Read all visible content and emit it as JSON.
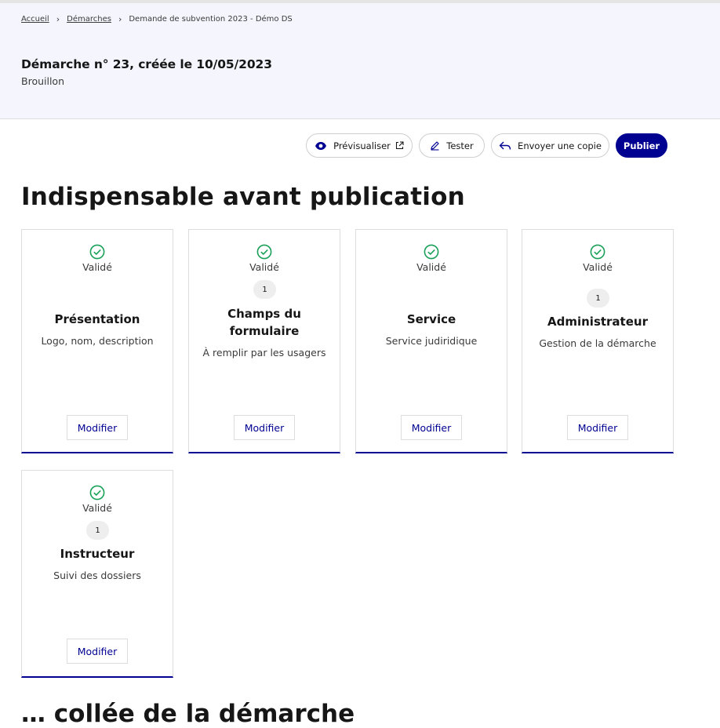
{
  "breadcrumb": {
    "home": "Accueil",
    "procedures": "Démarches",
    "current": "Demande de subvention 2023 - Démo DS"
  },
  "header": {
    "title": "Démarche n° 23, créée le 10/05/2023",
    "status": "Brouillon"
  },
  "actions": {
    "preview": "Prévisualiser",
    "test": "Tester",
    "send_copy": "Envoyer une copie",
    "publish": "Publier"
  },
  "section": {
    "title": "Indispensable avant publication",
    "next_title": "… collée de la démarche"
  },
  "cards": [
    {
      "status": "Validé",
      "badge": "",
      "title": "Présentation",
      "description": "Logo, nom, description",
      "button": "Modifier"
    },
    {
      "status": "Validé",
      "badge": "1",
      "title": "Champs du formulaire",
      "description": "À remplir par les usagers",
      "button": "Modifier"
    },
    {
      "status": "Validé",
      "badge": "",
      "title": "Service",
      "description": "Service judiridique",
      "button": "Modifier"
    },
    {
      "status": "Validé",
      "badge": "1",
      "title": "Administrateur",
      "description": "Gestion de la démarche",
      "button": "Modifier"
    },
    {
      "status": "Validé",
      "badge": "1",
      "title": "Instructeur",
      "description": "Suivi des dossiers",
      "button": "Modifier"
    }
  ],
  "colors": {
    "primary": "#000091",
    "success": "#18a058",
    "header_bg": "#f5f5fe"
  }
}
